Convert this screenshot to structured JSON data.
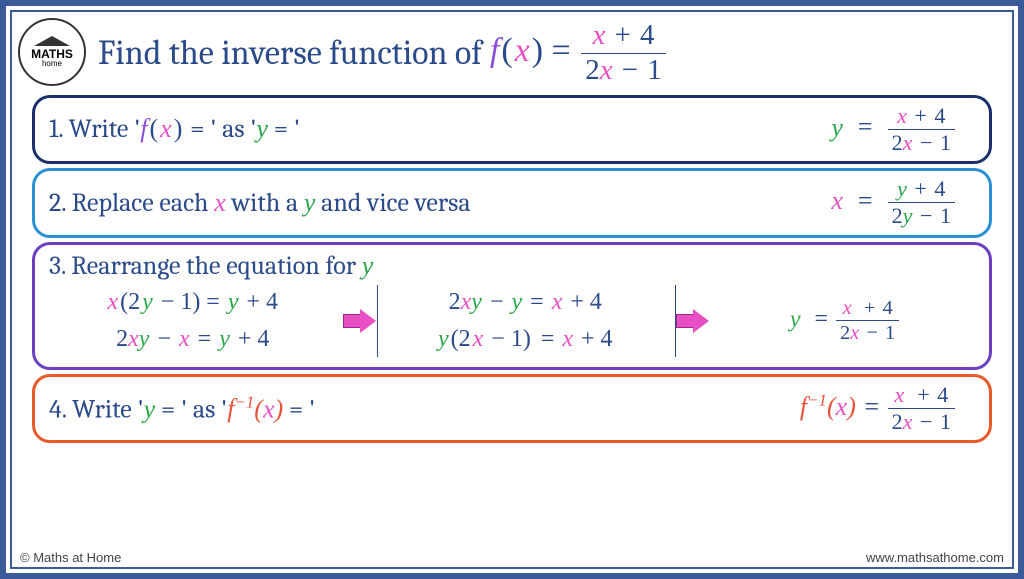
{
  "logo": {
    "text": "MATHS",
    "sub": "home"
  },
  "title": {
    "prefix": "Find the inverse function of ",
    "func": "f",
    "var": "x",
    "numL": "x",
    "numOp": "+",
    "numR": "4",
    "denL": "2",
    "denM": "x",
    "denOp": "−",
    "denR": "1"
  },
  "step1": {
    "label": "1. Write '",
    "fx": "f",
    "fxarg": "x",
    "mid": " = ' as '",
    "yvar": "y",
    "end": " = '",
    "eq": {
      "lhs": "y",
      "eq": "=",
      "numL": "x",
      "numOp": "+",
      "numR": "4",
      "denL": "2",
      "denM": "x",
      "denOp": "−",
      "denR": "1"
    }
  },
  "step2": {
    "label": "2. Replace each ",
    "x": "x",
    "mid": " with a ",
    "y": "y",
    "end": " and vice versa",
    "eq": {
      "lhs": "x",
      "eq": "=",
      "numL": "y",
      "numOp": "+",
      "numR": "4",
      "denL": "2",
      "denM": "y",
      "denOp": "−",
      "denR": "1"
    }
  },
  "step3": {
    "label": "3. Rearrange the equation for ",
    "y": "y",
    "col1": {
      "line1": {
        "a": "x",
        "b": "(2",
        "c": "y",
        "d": " − 1)  =  ",
        "e": "y",
        "f": " + 4"
      },
      "line2": {
        "a": "2",
        "b": "x",
        "c": "y",
        "d": " − ",
        "e": "x",
        "f": "  =  ",
        "g": "y",
        "h": " + 4"
      }
    },
    "col2": {
      "line1": {
        "a": "2",
        "b": "x",
        "c": "y",
        "d": " − ",
        "e": "y",
        "f": "  =  ",
        "g": "x",
        "h": " + 4"
      },
      "line2": {
        "a": "y",
        "b": "(2",
        "c": "x",
        "d": "  − 1)",
        "e": " =  ",
        "f": "x",
        "g": " + 4"
      }
    },
    "col3": {
      "lhs": "y",
      "eq": "=",
      "numL": "x",
      "numOp": "+",
      "numR": "4",
      "denL": "2",
      "denM": "x",
      "denOp": "−",
      "denR": "1"
    }
  },
  "step4": {
    "label": "4. Write '",
    "y": "y",
    "mid": " = ' as '",
    "fexp": "f",
    "sup": "−1",
    "arg": "x",
    "end": " = '",
    "eq": {
      "f": "f",
      "sup": "−1",
      "arg": "x",
      "eq": " = ",
      "numL": "x",
      "numOp": "+",
      "numR": "4",
      "denL": "2",
      "denM": "x",
      "denOp": "−",
      "denR": "1"
    }
  },
  "footer": {
    "left": "© Maths at Home",
    "right": "www.mathsathome.com"
  }
}
